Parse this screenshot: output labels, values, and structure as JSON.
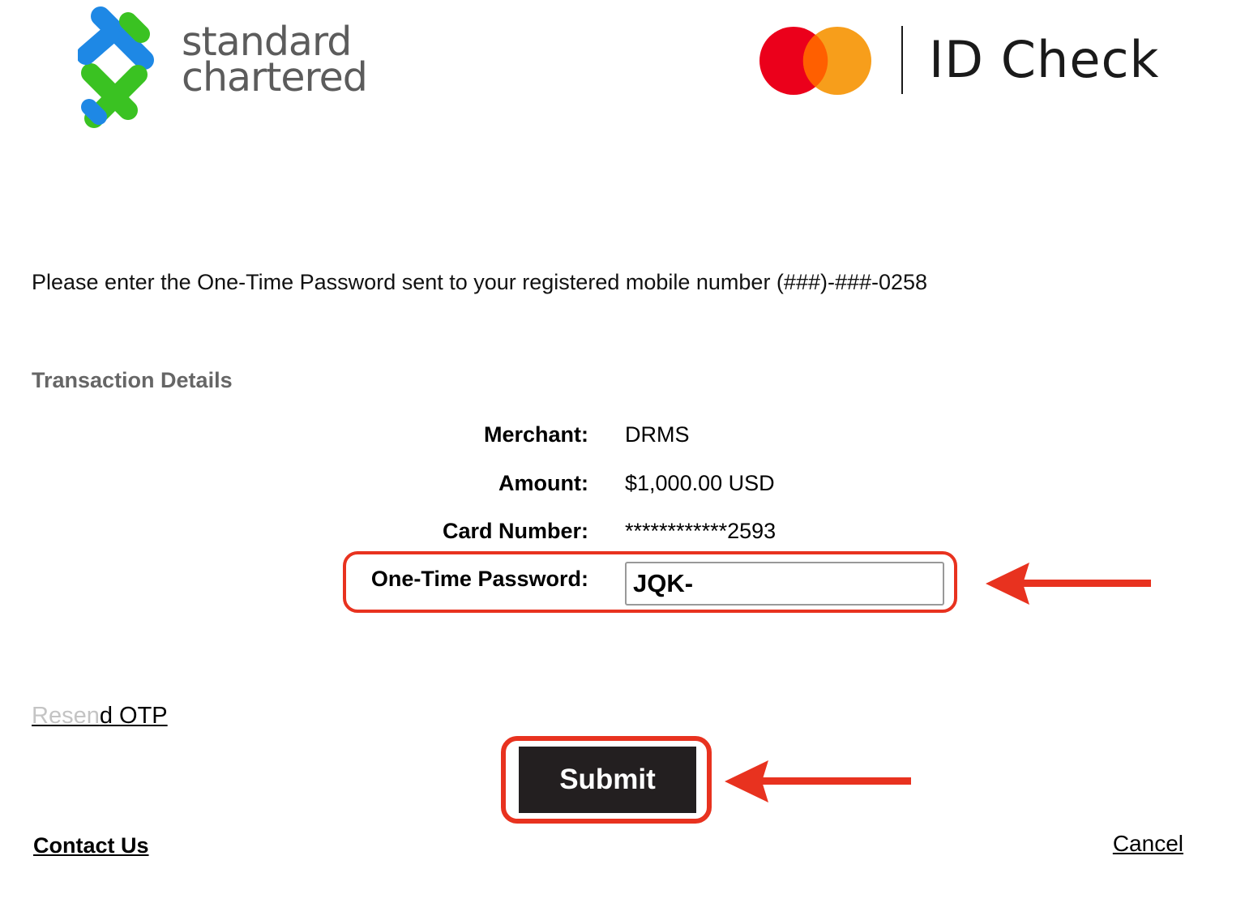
{
  "header": {
    "bank_logo": {
      "line1": "standard",
      "line2": "chartered",
      "colors": {
        "blue": "#1e88e5",
        "green": "#3ac222",
        "text": "#5c5c5c"
      }
    },
    "network_logo": {
      "brand": "ID Check",
      "colors": {
        "red": "#eb001b",
        "orange": "#f79e1b",
        "overlap": "#ff5f00"
      }
    }
  },
  "instruction": "Please enter the One-Time Password sent to your registered mobile number (###)-###-0258",
  "transaction": {
    "section_title": "Transaction Details",
    "rows": [
      {
        "label": "Merchant:",
        "value": "DRMS"
      },
      {
        "label": "Amount:",
        "value": "$1,000.00 USD"
      },
      {
        "label": "Card Number:",
        "value": "************2593"
      }
    ],
    "otp": {
      "label": "One-Time Password:",
      "value": "JQK-"
    }
  },
  "actions": {
    "resend_faded": "Resen",
    "resend_dark": "d OTP",
    "submit_label": "Submit",
    "contact_label": "Contact Us",
    "cancel_label": "Cancel"
  },
  "annotation_color": "#e8321f"
}
